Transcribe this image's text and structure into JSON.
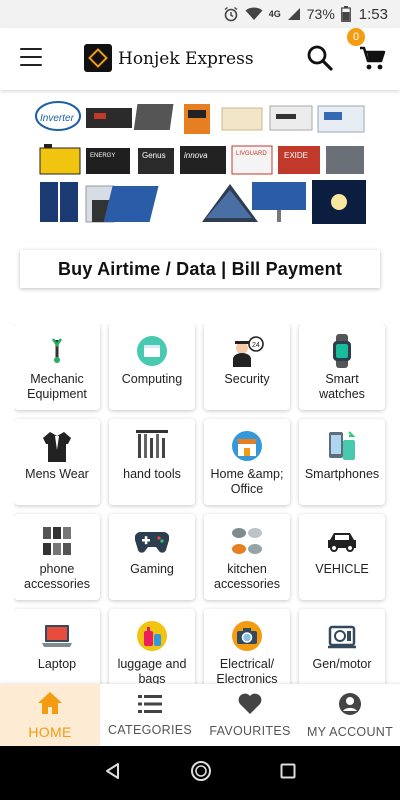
{
  "status_bar": {
    "network": "4G",
    "battery": "73%",
    "time": "1:53"
  },
  "app_bar": {
    "title": "Honjek Express",
    "logo_text": "EXPRESS",
    "cart_count": "0"
  },
  "banner": {
    "brand_text": "Inverter",
    "product_labels": [
      "Genus",
      "innova",
      "LIVGUARD",
      "EXIDE"
    ]
  },
  "bill_bar": {
    "label": "Buy Airtime / Data |   Bill Payment"
  },
  "categories": [
    {
      "label": "Mechanic Equipment",
      "icon": "wrench-icon"
    },
    {
      "label": "Computing",
      "icon": "computing-icon"
    },
    {
      "label": "Security",
      "icon": "security-guard-icon"
    },
    {
      "label": "Smart watches",
      "icon": "smartwatch-icon"
    },
    {
      "label": "Mens Wear",
      "icon": "jacket-icon"
    },
    {
      "label": "hand tools",
      "icon": "tools-icon"
    },
    {
      "label": "Home &amp; Office",
      "icon": "store-icon"
    },
    {
      "label": "Smartphones",
      "icon": "smartphone-icon"
    },
    {
      "label": "phone accessories",
      "icon": "phone-accessories-icon"
    },
    {
      "label": "Gaming",
      "icon": "gamepad-icon"
    },
    {
      "label": "kitchen accessories",
      "icon": "kitchen-icon"
    },
    {
      "label": "VEHICLE",
      "icon": "car-icon"
    },
    {
      "label": "Laptop",
      "icon": "laptop-icon"
    },
    {
      "label": "luggage and bags",
      "icon": "luggage-icon"
    },
    {
      "label": "Electrical/ Electronics",
      "icon": "camera-icon"
    },
    {
      "label": "Gen/motor",
      "icon": "generator-icon"
    }
  ],
  "bottom_nav": [
    {
      "label": "HOME",
      "icon": "home-icon",
      "active": true
    },
    {
      "label": "CATEGORIES",
      "icon": "list-icon",
      "active": false
    },
    {
      "label": "FAVOURITES",
      "icon": "heart-icon",
      "active": false
    },
    {
      "label": "MY ACCOUNT",
      "icon": "account-icon",
      "active": false
    }
  ],
  "colors": {
    "accent": "#f39c12",
    "active_nav_bg": "#fdebd3"
  }
}
